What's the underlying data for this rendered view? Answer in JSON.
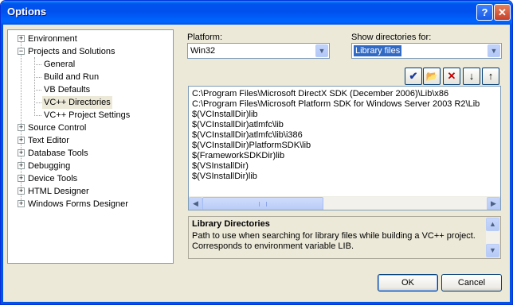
{
  "window": {
    "title": "Options",
    "help_glyph": "?",
    "close_glyph": "✕"
  },
  "tree": {
    "items": [
      {
        "label": "Environment",
        "expander": "+"
      },
      {
        "label": "Projects and Solutions",
        "expander": "−"
      },
      {
        "label": "General"
      },
      {
        "label": "Build and Run"
      },
      {
        "label": "VB Defaults"
      },
      {
        "label": "VC++ Directories",
        "selected": true
      },
      {
        "label": "VC++ Project Settings"
      },
      {
        "label": "Source Control",
        "expander": "+"
      },
      {
        "label": "Text Editor",
        "expander": "+"
      },
      {
        "label": "Database Tools",
        "expander": "+"
      },
      {
        "label": "Debugging",
        "expander": "+"
      },
      {
        "label": "Device Tools",
        "expander": "+"
      },
      {
        "label": "HTML Designer",
        "expander": "+"
      },
      {
        "label": "Windows Forms Designer",
        "expander": "+"
      }
    ]
  },
  "platform": {
    "label": "Platform:",
    "value": "Win32"
  },
  "show_dirs": {
    "label": "Show directories for:",
    "value": "Library files"
  },
  "toolbar": {
    "check_glyph": "✔",
    "new_folder_glyph": "📂",
    "delete_glyph": "✕",
    "down_glyph": "↓",
    "up_glyph": "↑"
  },
  "directories": [
    "C:\\Program Files\\Microsoft DirectX SDK (December 2006)\\Lib\\x86",
    "C:\\Program Files\\Microsoft Platform SDK for Windows Server 2003 R2\\Lib",
    "$(VCInstallDir)lib",
    "$(VCInstallDir)atlmfc\\lib",
    "$(VCInstallDir)atlmfc\\lib\\i386",
    "$(VCInstallDir)PlatformSDK\\lib",
    "$(FrameworkSDKDir)lib",
    "$(VSInstallDir)",
    "$(VSInstallDir)lib"
  ],
  "description": {
    "title": "Library Directories",
    "text": "Path to use when searching for library files while building a VC++ project. Corresponds to environment variable LIB."
  },
  "buttons": {
    "ok": "OK",
    "cancel": "Cancel"
  },
  "colors": {
    "titlebar": "#0054e3",
    "selection": "#316ac5",
    "face": "#ece9d8"
  }
}
